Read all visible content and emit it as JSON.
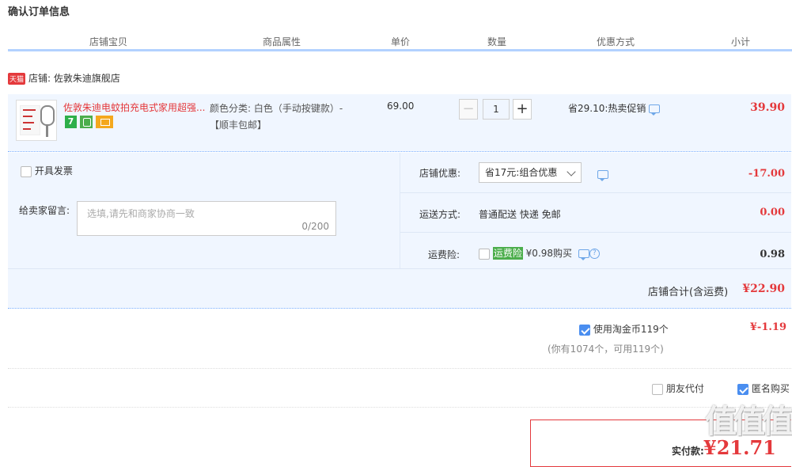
{
  "page_title": "确认订单信息",
  "columns": [
    "店铺宝贝",
    "商品属性",
    "单价",
    "数量",
    "优惠方式",
    "小计"
  ],
  "shop": {
    "badge": "天猫",
    "label": "店铺: 佐敦朱迪旗舰店"
  },
  "item": {
    "name": "佐敦朱迪电蚊拍充电式家用超强...",
    "service_badge": "7",
    "attr_line1": "颜色分类: 白色（手动按键款）-",
    "attr_line2": "【顺丰包邮】",
    "price": "69.00",
    "quantity": "1",
    "minus": "−",
    "plus": "+",
    "promo": "省29.10:热卖促销",
    "subtotal": "39.90"
  },
  "options": {
    "invoice_label": "开具发票",
    "message_label": "给卖家留言:",
    "message_placeholder": "选填,请先和商家协商一致",
    "message_count": "0/200",
    "shop_discount_label": "店铺优惠:",
    "shop_discount_value": "省17元:组合优惠",
    "shop_discount_amount": "-17.00",
    "delivery_label": "运送方式:",
    "delivery_value": "普通配送 快递 免邮",
    "delivery_amount": "0.00",
    "insurance_label": "运费险:",
    "insurance_tag": "运费险",
    "insurance_text": "¥0.98购买",
    "insurance_amount": "0.98",
    "shop_total_label": "店铺合计(含运费)",
    "shop_total_amount": "¥22.90"
  },
  "coins": {
    "label": "使用淘金币119个",
    "note": "(你有1074个，可用119个)",
    "amount": "¥-1.19"
  },
  "friends": {
    "friend_pay": "朋友代付",
    "anonymous": "匿名购买"
  },
  "pay": {
    "label": "实付款:",
    "amount": "¥21.71"
  },
  "watermark": "值值值"
}
